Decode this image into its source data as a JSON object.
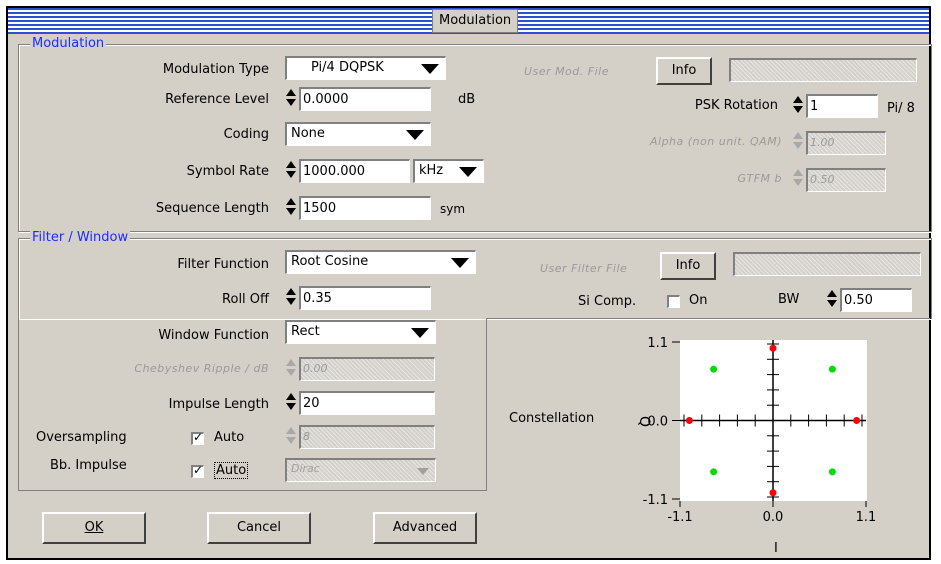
{
  "window": {
    "title": "Modulation"
  },
  "modulation": {
    "group_title": "Modulation",
    "type_label": "Modulation Type",
    "type_value": "Pi/4 DQPSK",
    "ref_level_label": "Reference Level",
    "ref_level_value": "0.0000",
    "ref_level_unit": "dB",
    "coding_label": "Coding",
    "coding_value": "None",
    "symbol_rate_label": "Symbol  Rate",
    "symbol_rate_value": "1000.000",
    "symbol_rate_unit": "kHz",
    "seq_len_label": "Sequence Length",
    "seq_len_value": "1500",
    "seq_len_unit": "sym",
    "user_mod_file_label": "User Mod. File",
    "info_label": "Info",
    "psk_rotation_label": "PSK Rotation",
    "psk_rotation_value": "1",
    "psk_rotation_unit": "Pi/ 8",
    "alpha_label": "Alpha (non unit. QAM)",
    "alpha_value": "1.00",
    "gtfm_label": "GTFM b",
    "gtfm_value": "0.50"
  },
  "filter": {
    "group_title": "Filter / Window",
    "filter_function_label": "Filter Function",
    "filter_function_value": "Root Cosine",
    "roll_off_label": "Roll Off",
    "roll_off_value": "0.35",
    "user_filter_file_label": "User Filter File",
    "info_label": "Info",
    "si_comp_label": "Si Comp.",
    "si_comp_on_label": "On",
    "si_comp_checked": false,
    "bw_label": "BW",
    "bw_value": "0.50",
    "window_function_label": "Window Function",
    "window_function_value": "Rect",
    "chebyshev_label": "Chebyshev Ripple / dB",
    "chebyshev_value": "0.00",
    "impulse_length_label": "Impulse Length",
    "impulse_length_value": "20",
    "oversampling_label": "Oversampling",
    "oversampling_auto_label": "Auto",
    "oversampling_auto_checked": true,
    "oversampling_value": "8",
    "bb_impulse_label": "Bb. Impulse",
    "bb_impulse_auto_label": "Auto",
    "bb_impulse_auto_checked": true,
    "bb_impulse_value": "Dirac"
  },
  "buttons": {
    "ok": "OK",
    "cancel": "Cancel",
    "advanced": "Advanced"
  },
  "colors": {
    "title_stripe": "#2b4fd6",
    "group_title": "#1b2cff",
    "face": "#d4d0c8",
    "red_point": "#ff0000",
    "green_point": "#00dd00"
  },
  "chart_data": {
    "type": "scatter",
    "title": "Constellation",
    "xlabel": "I",
    "ylabel": "Q",
    "xlim": [
      -1.1,
      1.1
    ],
    "ylim": [
      -1.1,
      1.1
    ],
    "x_ticks": [
      "-1.1",
      "0.0",
      "1.1"
    ],
    "y_ticks": [
      "1.1",
      "0.0",
      "-1.1"
    ],
    "series": [
      {
        "color": "#ff0000",
        "points": [
          [
            0,
            1.0
          ],
          [
            0,
            -1.0
          ],
          [
            -1.0,
            0
          ],
          [
            1.0,
            0
          ]
        ]
      },
      {
        "color": "#00dd00",
        "points": [
          [
            -0.71,
            0.71
          ],
          [
            0.71,
            0.71
          ],
          [
            -0.71,
            -0.71
          ],
          [
            0.71,
            -0.71
          ]
        ]
      }
    ]
  }
}
